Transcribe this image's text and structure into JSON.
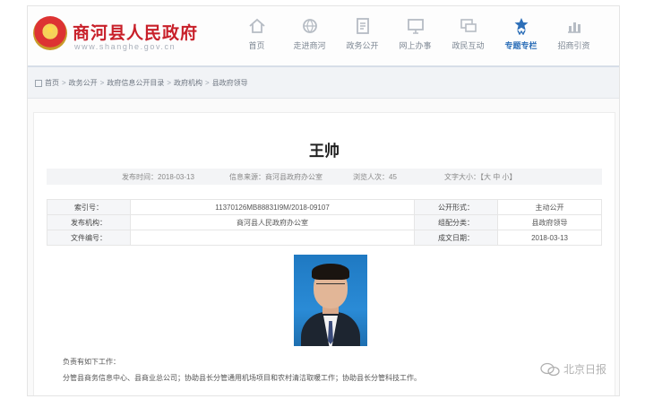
{
  "site": {
    "title": "商河县人民政府",
    "url": "www.shanghe.gov.cn"
  },
  "nav": {
    "items": [
      {
        "label": "首页",
        "icon": "home-icon"
      },
      {
        "label": "走进商河",
        "icon": "globe-icon"
      },
      {
        "label": "政务公开",
        "icon": "document-icon"
      },
      {
        "label": "网上办事",
        "icon": "monitor-icon"
      },
      {
        "label": "政民互动",
        "icon": "chat-icon"
      },
      {
        "label": "专题专栏",
        "icon": "ribbon-star-icon",
        "active": true
      },
      {
        "label": "招商引资",
        "icon": "bar-chart-icon"
      }
    ]
  },
  "breadcrumb": [
    "首页",
    "政务公开",
    "政府信息公开目录",
    "政府机构",
    "县政府领导"
  ],
  "person": {
    "name": "王帅"
  },
  "meta": {
    "publish_date": "发布时间：2018-03-13",
    "source": "信息来源：商河县政府办公室",
    "views": "浏览人次：45",
    "font_size": "文字大小：【大 中 小】"
  },
  "info_table": {
    "rows": [
      [
        "索引号：",
        "11370126MB88831I9M/2018-09107",
        "公开形式：",
        "主动公开"
      ],
      [
        "发布机构：",
        "商河县人民政府办公室",
        "组配分类：",
        "县政府领导"
      ],
      [
        "文件编号：",
        "",
        "成文日期：",
        "2018-03-13"
      ]
    ]
  },
  "bio": {
    "heading": "负责有如下工作：",
    "duties": "分管县商务信息中心、县商业总公司；协助县长分管通用机场项目和农村清洁取暖工作；协助县长分管科技工作。"
  },
  "watermark": {
    "text": "北京日报"
  },
  "colors": {
    "title_red": "#c8202a",
    "nav_active": "#2d6fb8",
    "photo_bg": "#1f79c2"
  }
}
